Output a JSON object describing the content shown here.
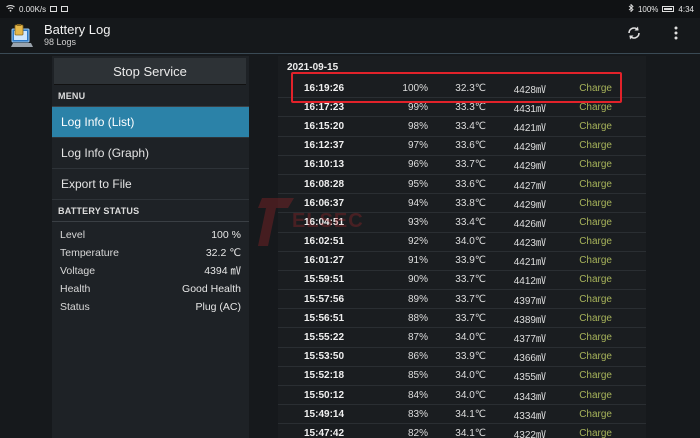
{
  "statusbar": {
    "speed": "0.00K/s",
    "battery": "100%",
    "time": "4:34"
  },
  "app": {
    "title": "Battery Log",
    "subtitle": "98 Logs"
  },
  "sidebar": {
    "stop_button": "Stop Service",
    "menu_header": "MENU",
    "menu_items": [
      {
        "label": "Log Info (List)",
        "active": true
      },
      {
        "label": "Log Info (Graph)",
        "active": false
      },
      {
        "label": "Export to File",
        "active": false
      }
    ],
    "status_header": "BATTERY STATUS",
    "status": [
      {
        "label": "Level",
        "value": "100 %"
      },
      {
        "label": "Temperature",
        "value": "32.2 ℃"
      },
      {
        "label": "Voltage",
        "value": "4394 ㎷"
      },
      {
        "label": "Health",
        "value": "Good Health"
      },
      {
        "label": "Status",
        "value": "Plug (AC)"
      }
    ]
  },
  "log": {
    "date": "2021-09-15",
    "rows": [
      {
        "time": "16:19:26",
        "pct": "100%",
        "temp": "32.3℃",
        "volt": "4428㎷",
        "state": "Charge"
      },
      {
        "time": "16:17:23",
        "pct": "99%",
        "temp": "33.3℃",
        "volt": "4431㎷",
        "state": "Charge"
      },
      {
        "time": "16:15:20",
        "pct": "98%",
        "temp": "33.4℃",
        "volt": "4421㎷",
        "state": "Charge"
      },
      {
        "time": "16:12:37",
        "pct": "97%",
        "temp": "33.6℃",
        "volt": "4429㎷",
        "state": "Charge"
      },
      {
        "time": "16:10:13",
        "pct": "96%",
        "temp": "33.7℃",
        "volt": "4429㎷",
        "state": "Charge"
      },
      {
        "time": "16:08:28",
        "pct": "95%",
        "temp": "33.6℃",
        "volt": "4427㎷",
        "state": "Charge"
      },
      {
        "time": "16:06:37",
        "pct": "94%",
        "temp": "33.8℃",
        "volt": "4429㎷",
        "state": "Charge"
      },
      {
        "time": "16:04:51",
        "pct": "93%",
        "temp": "33.4℃",
        "volt": "4426㎷",
        "state": "Charge"
      },
      {
        "time": "16:02:51",
        "pct": "92%",
        "temp": "34.0℃",
        "volt": "4423㎷",
        "state": "Charge"
      },
      {
        "time": "16:01:27",
        "pct": "91%",
        "temp": "33.9℃",
        "volt": "4421㎷",
        "state": "Charge"
      },
      {
        "time": "15:59:51",
        "pct": "90%",
        "temp": "33.7℃",
        "volt": "4412㎷",
        "state": "Charge"
      },
      {
        "time": "15:57:56",
        "pct": "89%",
        "temp": "33.7℃",
        "volt": "4397㎷",
        "state": "Charge"
      },
      {
        "time": "15:56:51",
        "pct": "88%",
        "temp": "33.7℃",
        "volt": "4389㎷",
        "state": "Charge"
      },
      {
        "time": "15:55:22",
        "pct": "87%",
        "temp": "34.0℃",
        "volt": "4377㎷",
        "state": "Charge"
      },
      {
        "time": "15:53:50",
        "pct": "86%",
        "temp": "33.9℃",
        "volt": "4366㎷",
        "state": "Charge"
      },
      {
        "time": "15:52:18",
        "pct": "85%",
        "temp": "34.0℃",
        "volt": "4355㎷",
        "state": "Charge"
      },
      {
        "time": "15:50:12",
        "pct": "84%",
        "temp": "34.0℃",
        "volt": "4343㎷",
        "state": "Charge"
      },
      {
        "time": "15:49:14",
        "pct": "83%",
        "temp": "34.1℃",
        "volt": "4334㎷",
        "state": "Charge"
      },
      {
        "time": "15:47:42",
        "pct": "82%",
        "temp": "34.1℃",
        "volt": "4322㎷",
        "state": "Charge"
      }
    ]
  },
  "watermark": {
    "text": "ELSEC"
  },
  "icons": {
    "refresh": "refresh-icon",
    "overflow": "more-vert-icon",
    "app": "battery-log-app-icon"
  },
  "colors": {
    "accent": "#2b82a8",
    "charge": "#a7b35a",
    "highlight": "#e2222a"
  }
}
